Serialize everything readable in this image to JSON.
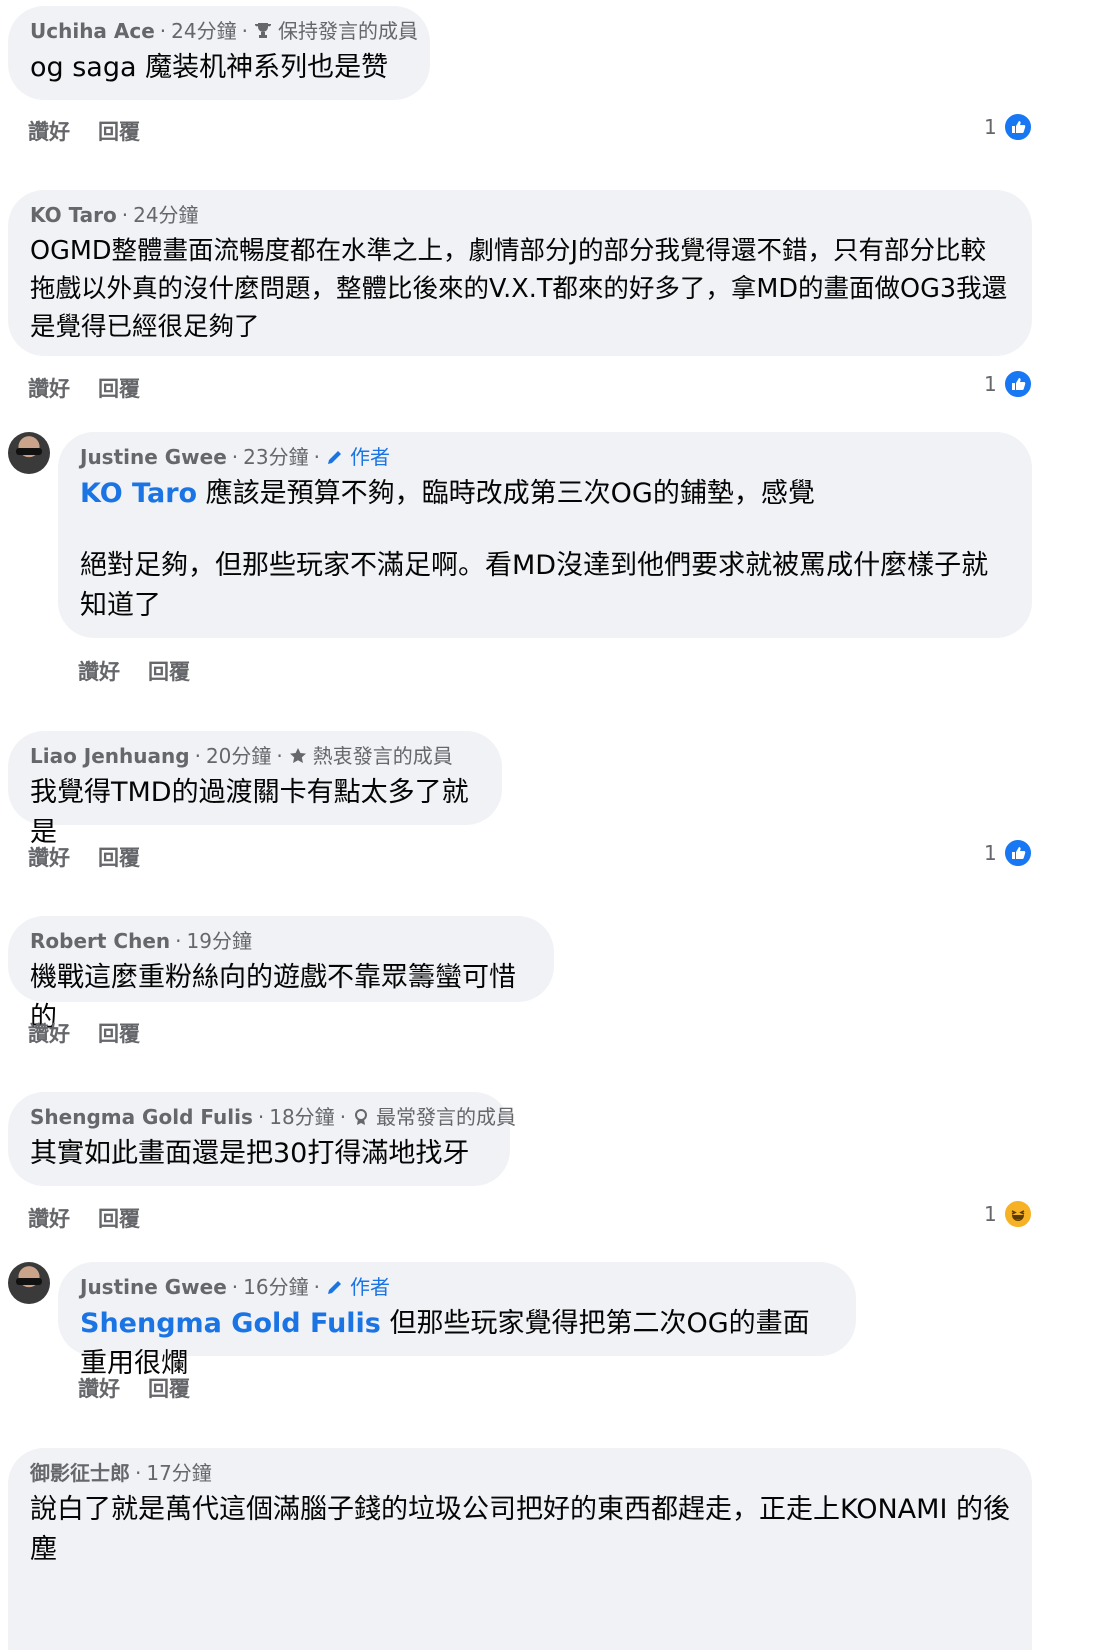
{
  "actions": {
    "like": "讚好",
    "reply": "回覆"
  },
  "comments": [
    {
      "author": "Uchiha Ace",
      "time": "24分鐘",
      "badge": "保持發言的成員",
      "badge_icon": "trophy-icon",
      "text": "og saga 魔装机神系列也是赞",
      "reactions": "1",
      "reaction_type": "like-icon"
    },
    {
      "author": "KO Taro",
      "time": "24分鐘",
      "text": "OGMD整體畫面流暢度都在水準之上，劇情部分J的部分我覺得還不錯，只有部分比較拖戲以外真的沒什麼問題，整體比後來的V.X.T都來的好多了，拿MD的畫面做OG3我還是覺得已經很足夠了",
      "reactions": "1",
      "reaction_type": "like-icon"
    },
    {
      "author": "Justine Gwee",
      "time": "23分鐘",
      "badge": "作者",
      "badge_icon": "pencil-icon",
      "mention": "KO Taro",
      "text": " 應該是預算不夠，臨時改成第三次OG的鋪墊，感覺",
      "text2": "絕對足夠，但那些玩家不滿足啊。看MD沒達到他們要求就被罵成什麼樣子就知道了"
    },
    {
      "author": "Liao Jenhuang",
      "time": "20分鐘",
      "badge": "熱衷發言的成員",
      "badge_icon": "star-icon",
      "text": "我覺得TMD的過渡關卡有點太多了就是",
      "reactions": "1",
      "reaction_type": "like-icon"
    },
    {
      "author": "Robert Chen",
      "time": "19分鐘",
      "text": "機戰這麼重粉絲向的遊戲不靠眾籌蠻可惜的"
    },
    {
      "author": "Shengma Gold Fulis",
      "time": "18分鐘",
      "badge": "最常發言的成員",
      "badge_icon": "medal-icon",
      "text": "其實如此畫面還是把30打得滿地找牙",
      "reactions": "1",
      "reaction_type": "haha-icon"
    },
    {
      "author": "Justine Gwee",
      "time": "16分鐘",
      "badge": "作者",
      "badge_icon": "pencil-icon",
      "mention": "Shengma Gold Fulis",
      "text": " 但那些玩家覺得把第二次OG的畫面重用很爛"
    },
    {
      "author": "御影征士郎",
      "time": "17分鐘",
      "text": "說白了就是萬代這個滿腦子錢的垃圾公司把好的東西都趕走，正走上KONAMI 的後塵"
    }
  ]
}
